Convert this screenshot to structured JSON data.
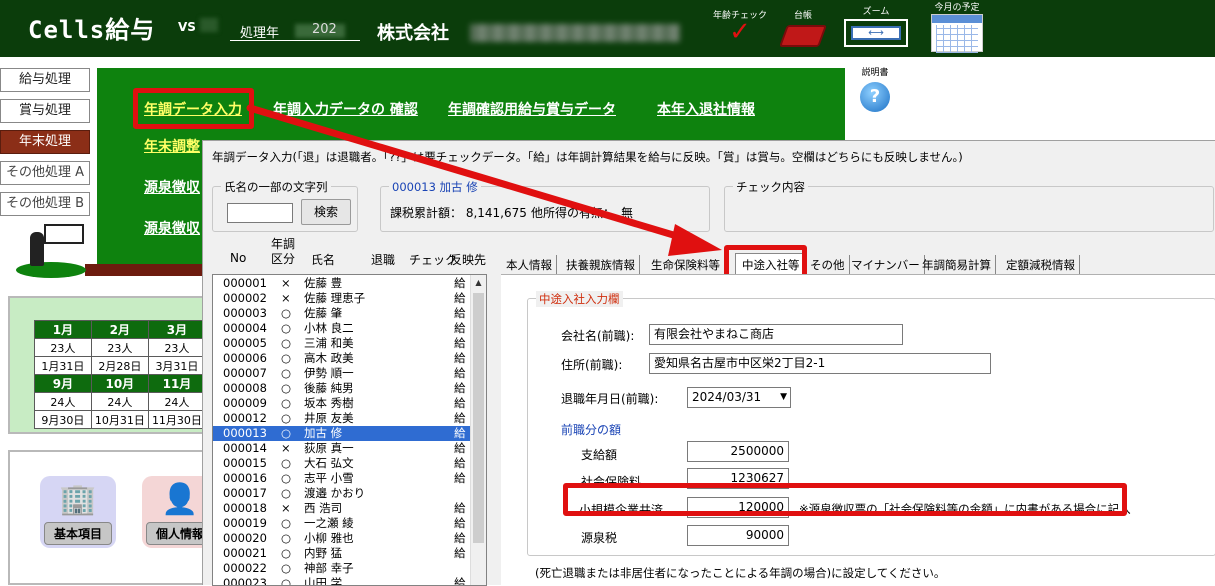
{
  "header": {
    "app_title": "Cells給与",
    "version_label": "VS",
    "year_label": "処理年",
    "year_value": "202",
    "company": "株式会社",
    "tools": {
      "age_check": "年齢チェック",
      "ledger": "台帳",
      "zoom": "ズーム",
      "schedule": "今月の予定"
    }
  },
  "left_menu": {
    "items": [
      "給与処理",
      "賞与処理",
      "年末処理",
      "その他処理 A",
      "その他処理 B"
    ]
  },
  "green_menu": {
    "row1": [
      "年調データ入力",
      "年調入力データの 確認",
      "年調確認用給与賞与データ",
      "本年入退社情報"
    ],
    "row2": [
      "年末調整",
      "",
      "",
      ""
    ],
    "row3": [
      "源泉徴収",
      ""
    ],
    "row4": [
      "源泉徴収",
      ""
    ]
  },
  "help_label": "説明書",
  "calendar": {
    "months_top": [
      "1月",
      "2月",
      "3月"
    ],
    "counts_top": [
      "23人",
      "23人",
      "23人"
    ],
    "dates_top": [
      "1月31日",
      "2月28日",
      "3月31日"
    ],
    "months_bottom": [
      "9月",
      "10月",
      "11月"
    ],
    "counts_bottom": [
      "24人",
      "24人",
      "24人"
    ],
    "dates_bottom": [
      "9月30日",
      "10月31日",
      "11月30日"
    ]
  },
  "big_buttons": [
    "基本項目",
    "個人情報"
  ],
  "dialog": {
    "description": "年調データ入力(「退」は退職者。「??」は要チェックデータ。「給」は年調計算結果を給与に反映。「賞」は賞与。空欄はどちらにも反映しません。)",
    "search_group_title": "氏名の一部の文字列",
    "search_button": "検索",
    "employee_title": "000013 加古 修",
    "taxable_total": "課税累計額： 8,141,675",
    "other_income": "他所得の有無：",
    "other_income_value": "無",
    "check_group_title": "チェック内容",
    "columns": {
      "no": "No",
      "div": "年調\n区分",
      "name": "氏名",
      "retire": "退職",
      "check": "チェック",
      "reflect": "反映先"
    },
    "rows": [
      {
        "no": "000001",
        "div": "×",
        "name": "佐藤 豊",
        "ref": "給"
      },
      {
        "no": "000002",
        "div": "×",
        "name": "佐藤 理恵子",
        "ref": "給"
      },
      {
        "no": "000003",
        "div": "○",
        "name": "佐藤 肇",
        "ref": "給"
      },
      {
        "no": "000004",
        "div": "○",
        "name": "小林 良二",
        "ref": "給"
      },
      {
        "no": "000005",
        "div": "○",
        "name": "三浦 和美",
        "ref": "給"
      },
      {
        "no": "000006",
        "div": "○",
        "name": "高木 政美",
        "ref": "給"
      },
      {
        "no": "000007",
        "div": "○",
        "name": "伊勢 順一",
        "ref": "給"
      },
      {
        "no": "000008",
        "div": "○",
        "name": "後藤 純男",
        "ref": "給"
      },
      {
        "no": "000009",
        "div": "○",
        "name": "坂本 秀樹",
        "ref": "給"
      },
      {
        "no": "000012",
        "div": "○",
        "name": "井原 友美",
        "ref": "給"
      },
      {
        "no": "000013",
        "div": "○",
        "name": "加古 修",
        "ref": "給"
      },
      {
        "no": "000014",
        "div": "×",
        "name": "荻原 真一",
        "ref": "給"
      },
      {
        "no": "000015",
        "div": "○",
        "name": "大石 弘文",
        "ref": "給"
      },
      {
        "no": "000016",
        "div": "○",
        "name": "志平 小雪",
        "ref": "給"
      },
      {
        "no": "000017",
        "div": "○",
        "name": "渡邉 かおり",
        "ref": ""
      },
      {
        "no": "000018",
        "div": "×",
        "name": "西 浩司",
        "ref": "給"
      },
      {
        "no": "000019",
        "div": "○",
        "name": "一之瀬 綾",
        "ref": "給"
      },
      {
        "no": "000020",
        "div": "○",
        "name": "小柳 雅也",
        "ref": "給"
      },
      {
        "no": "000021",
        "div": "○",
        "name": "内野 猛",
        "ref": "給"
      },
      {
        "no": "000022",
        "div": "○",
        "name": "神部 幸子",
        "ref": ""
      },
      {
        "no": "000023",
        "div": "○",
        "name": "山田 学",
        "ref": "給"
      }
    ],
    "selected_row": 10,
    "tabs": [
      "本人情報",
      "扶養親族情報",
      "生命保険料等",
      "中途入社等",
      "その他",
      "マイナンバー",
      "年調簡易計算",
      "定額減税情報"
    ],
    "active_tab": 3,
    "section_title": "中途入社入力欄",
    "company_label": "会社名(前職):",
    "company_value": "有限会社やまねこ商店",
    "address_label": "住所(前職):",
    "address_value": "愛知県名古屋市中区栄2丁目2-1",
    "retire_label": "退職年月日(前職):",
    "retire_value": "2024/03/31",
    "prev_section": "前職分の額",
    "pay_label": "支給額",
    "pay_value": "2500000",
    "social_label": "社会保険料",
    "social_value": "1230627",
    "small_label": "小規模企業共済",
    "small_value": "120000",
    "small_note": "※源泉徴収票の「社会保険料等の金額」に内書がある場合に記入",
    "tax_label": "源泉税",
    "tax_value": "90000",
    "footer_note": "(死亡退職または非居住者になったことによる年調の場合)に設定してください。"
  },
  "colors": {
    "header_bg": "#0b3d0b",
    "menu_green": "#0e820e",
    "highlight_red": "#e01010",
    "selected_blue": "#2f6cd2"
  }
}
